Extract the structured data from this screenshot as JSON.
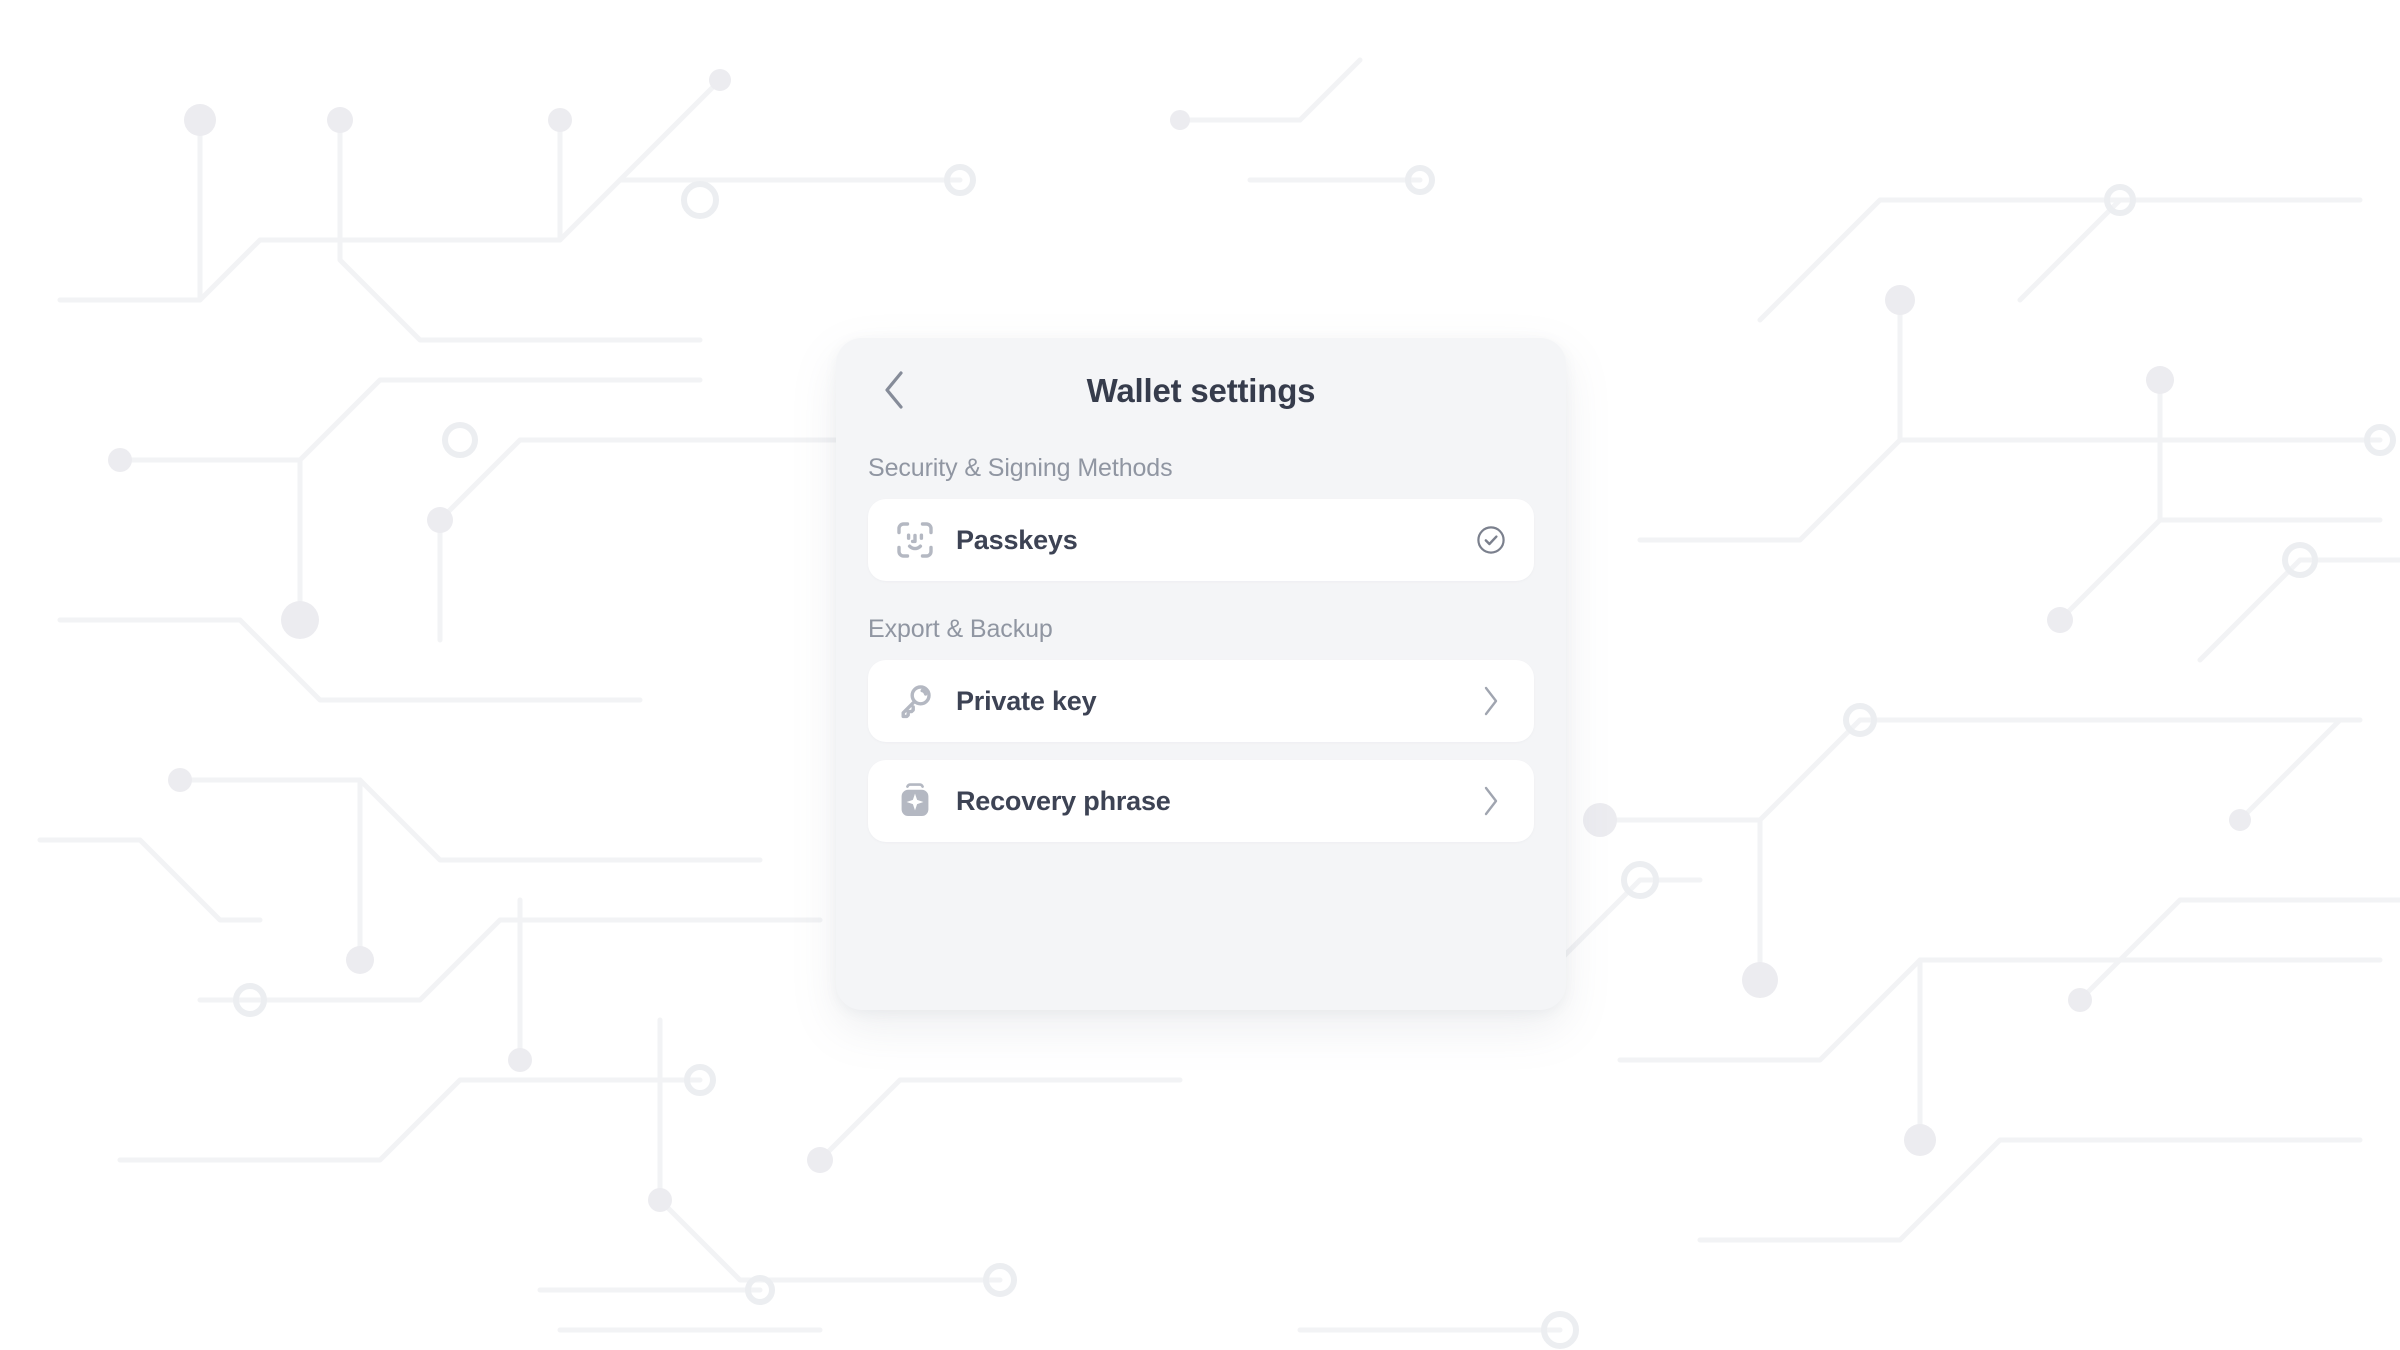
{
  "background": {
    "name": "circuit-board-pattern",
    "base_color": "#ffffff",
    "line_color": "#f2f3f5",
    "node_color": "#eceef1"
  },
  "card": {
    "background_color": "#f4f5f7",
    "row_color": "#ffffff",
    "title": "Wallet settings",
    "back_icon": "chevron-left-icon",
    "title_color": "#363c4c",
    "section_label_color": "#9096a2",
    "row_label_color": "#3d4354",
    "icon_color": "#b4b8c2",
    "sections": [
      {
        "label": "Security & Signing Methods",
        "items": [
          {
            "label": "Passkeys",
            "icon": "face-id-icon",
            "trailing_icon": "check-circle-icon",
            "state": "enabled"
          }
        ]
      },
      {
        "label": "Export & Backup",
        "items": [
          {
            "label": "Private key",
            "icon": "key-icon",
            "trailing_icon": "chevron-right-icon",
            "state": "navigable"
          },
          {
            "label": "Recovery phrase",
            "icon": "vault-sparkle-icon",
            "trailing_icon": "chevron-right-icon",
            "state": "navigable"
          }
        ]
      }
    ]
  }
}
